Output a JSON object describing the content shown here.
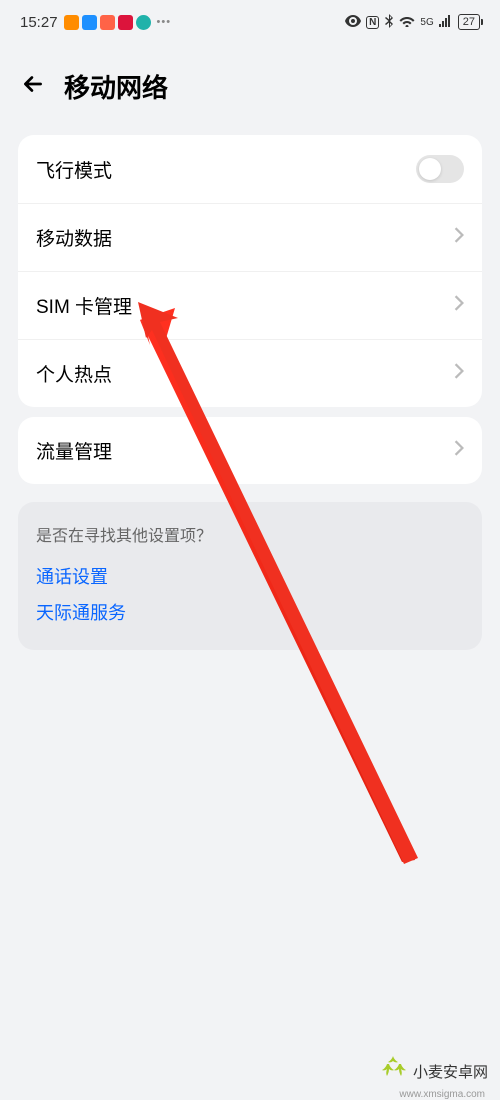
{
  "status": {
    "time": "15:27",
    "nfc": "N",
    "signal": "5G",
    "battery": "27"
  },
  "header": {
    "title": "移动网络"
  },
  "group1": {
    "airplane": "飞行模式",
    "mobile_data": "移动数据",
    "sim": "SIM 卡管理",
    "hotspot": "个人热点"
  },
  "group2": {
    "traffic": "流量管理"
  },
  "hint": {
    "title": "是否在寻找其他设置项？",
    "link1": "通话设置",
    "link2": "天际通服务"
  },
  "watermark": {
    "name": "小麦安卓网",
    "url": "www.xmsigma.com"
  }
}
